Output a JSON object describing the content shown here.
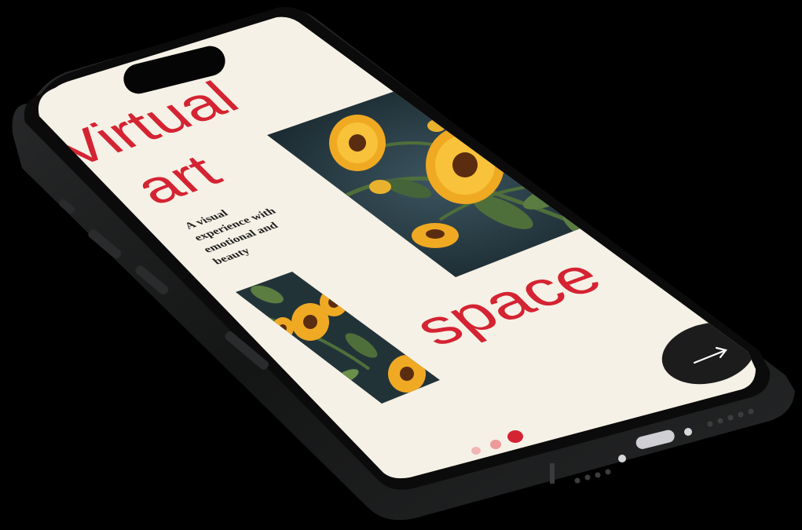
{
  "colors": {
    "background": "#000000",
    "device_frame": "#151616",
    "device_rim": "#2a2b2c",
    "screen_bg": "#f6f1e6",
    "accent_red": "#d42332",
    "text_dark": "#1d1d1d",
    "artwork_bg": "#24363c",
    "petal": "#f0a923",
    "petal_light": "#f8c23a",
    "flower_center": "#5a2d10",
    "leaf": "#4f6f3a",
    "button_bg": "#1c1c1c",
    "button_fg": "#ffffff"
  },
  "app": {
    "title_line1": "Virtual",
    "title_line2": "art",
    "title_line3": "space",
    "caption_lines": [
      "A visual",
      "experience with",
      "emotional and",
      "beauty"
    ],
    "next_button_icon": "arrow-right-icon",
    "pagination": {
      "count": 3,
      "active_index": 2
    }
  },
  "artworks": [
    {
      "subject": "sunflowers-large"
    },
    {
      "subject": "sunflowers-small"
    }
  ]
}
